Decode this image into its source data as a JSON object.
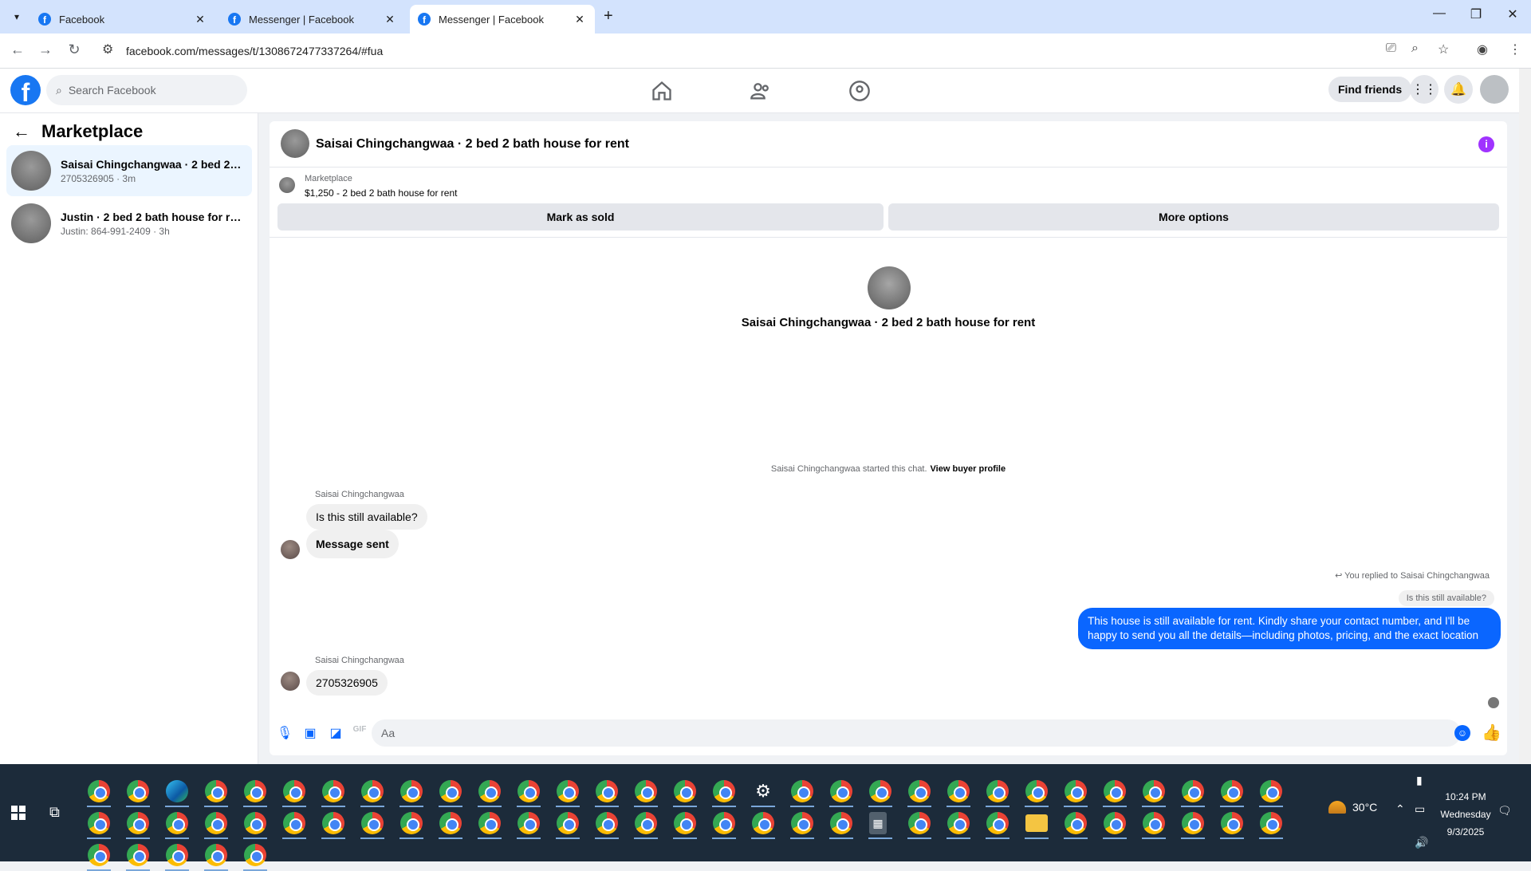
{
  "browser": {
    "tabs": [
      {
        "title": "Facebook",
        "active": false
      },
      {
        "title": "Messenger | Facebook",
        "active": false
      },
      {
        "title": "Messenger | Facebook",
        "active": true
      }
    ],
    "url": "facebook.com/messages/t/1308672477337264/#fua"
  },
  "fb_header": {
    "search_placeholder": "Search Facebook",
    "find_friends_label": "Find friends"
  },
  "sidebar": {
    "title": "Marketplace",
    "conversations": [
      {
        "name": "Saisai Chingchangwaa · 2 bed 2 ba...",
        "sub": "2705326905 · 3m",
        "active": true
      },
      {
        "name": "Justin · 2 bed 2 bath house for rent",
        "sub": "Justin: 864-991-2409 · 3h",
        "active": false
      }
    ]
  },
  "chat": {
    "header_title": "Saisai Chingchangwaa · 2 bed 2 bath house for rent",
    "listing": {
      "label": "Marketplace",
      "price_title": "$1,250 - 2 bed 2 bath house for rent",
      "mark_sold_label": "Mark as sold",
      "more_options_label": "More options"
    },
    "profile_name": "Saisai Chingchangwaa · 2 bed 2 bath house for rent",
    "started_text": "Saisai Chingchangwaa started this chat.",
    "view_buyer_label": "View buyer profile",
    "messages": [
      {
        "sender": "Saisai Chingchangwaa",
        "text": "Is this still available?"
      },
      {
        "text": "Message sent"
      },
      {
        "replied_label": "You replied to Saisai Chingchangwaa",
        "quoted": "Is this still available?",
        "text": "This house is still available for rent. Kindly share your contact number, and I'll be happy to send you all the details—including photos, pricing, and the exact location"
      },
      {
        "sender": "Saisai Chingchangwaa",
        "text": "2705326905"
      }
    ],
    "composer_placeholder": "Aa"
  },
  "taskbar": {
    "weather": "30°C",
    "time": "10:24 PM",
    "day": "Wednesday",
    "date": "9/3/2025"
  },
  "colors": {
    "facebook_blue": "#1877f2",
    "outgoing_bubble": "#0a66ff",
    "info_purple": "#a033ff",
    "taskbar_bg": "#1c2b3a",
    "tabstrip_bg": "#d3e3fd"
  }
}
